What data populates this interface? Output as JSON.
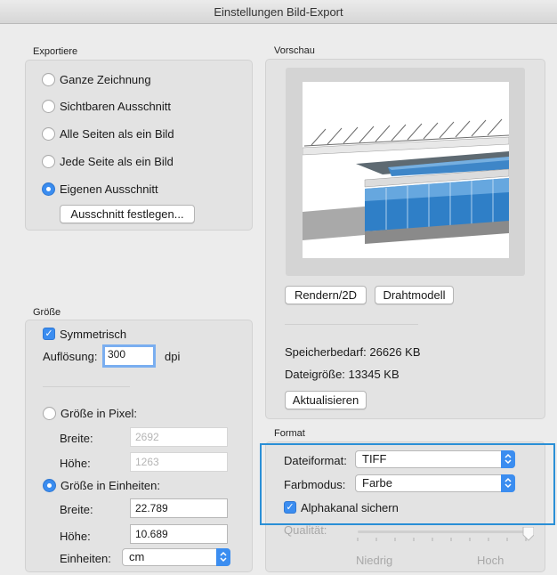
{
  "window": {
    "title": "Einstellungen Bild-Export"
  },
  "export": {
    "title": "Exportiere",
    "options": [
      "Ganze Zeichnung",
      "Sichtbaren Ausschnitt",
      "Alle Seiten als ein Bild",
      "Jede Seite als ein Bild",
      "Eigenen Ausschnitt"
    ],
    "selected": "Eigenen Ausschnitt",
    "define_button": "Ausschnitt festlegen..."
  },
  "size": {
    "title": "Größe",
    "symmetric_label": "Symmetrisch",
    "symmetric_checked": true,
    "resolution_label": "Auflösung:",
    "resolution_value": "300",
    "resolution_unit": "dpi",
    "pixel_label": "Größe in Pixel:",
    "pixel_width_label": "Breite:",
    "pixel_width_value": "2692",
    "pixel_height_label": "Höhe:",
    "pixel_height_value": "1263",
    "units_label": "Größe in Einheiten:",
    "units_selected": true,
    "unit_width_label": "Breite:",
    "unit_width_value": "22.789",
    "unit_height_label": "Höhe:",
    "unit_height_value": "10.689",
    "units_select_label": "Einheiten:",
    "units_select_value": "cm"
  },
  "preview": {
    "title": "Vorschau",
    "render_button": "Rendern/2D",
    "wireframe_button": "Drahtmodell",
    "memory_label": "Speicherbedarf:",
    "memory_value": "26626 KB",
    "filesize_label": "Dateigröße:",
    "filesize_value": "13345 KB",
    "refresh_button": "Aktualisieren"
  },
  "format": {
    "title": "Format",
    "fileformat_label": "Dateiformat:",
    "fileformat_value": "TIFF",
    "colormode_label": "Farbmodus:",
    "colormode_value": "Farbe",
    "alpha_label": "Alphakanal sichern",
    "alpha_checked": true,
    "quality_label": "Qualität:",
    "quality_low": "Niedrig",
    "quality_high": "Hoch",
    "highlight_color": "#2a8fd6"
  },
  "colors": {
    "accent": "#3b8df0"
  }
}
